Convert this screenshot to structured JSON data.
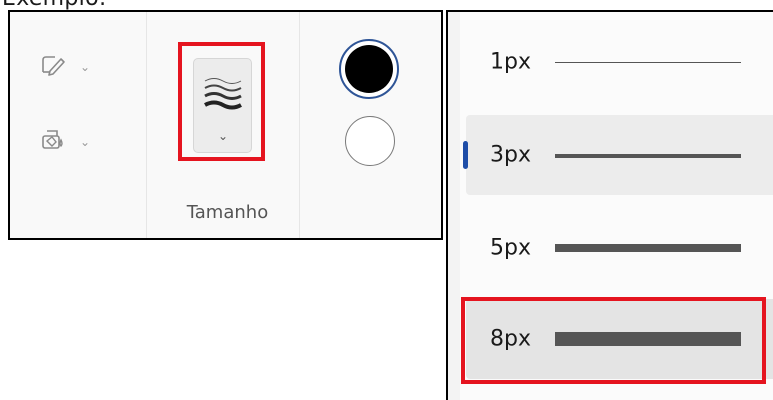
{
  "caption": "Exemplo:",
  "toolbar": {
    "pen_icon": "pen-outline-icon",
    "fill_icon": "paint-bucket-icon",
    "size_group_label": "Tamanho",
    "colors": {
      "black": "#000000",
      "white": "#ffffff",
      "selected_ring": "#2f5597"
    }
  },
  "size_menu": {
    "items": [
      {
        "label": "1px",
        "thickness": 1,
        "selected": false,
        "highlighted": false
      },
      {
        "label": "3px",
        "thickness": 3,
        "selected": true,
        "highlighted": false
      },
      {
        "label": "5px",
        "thickness": 5,
        "selected": false,
        "highlighted": false
      },
      {
        "label": "8px",
        "thickness": 8,
        "selected": false,
        "highlighted": true
      }
    ]
  },
  "annotation_color": "#e5141f"
}
